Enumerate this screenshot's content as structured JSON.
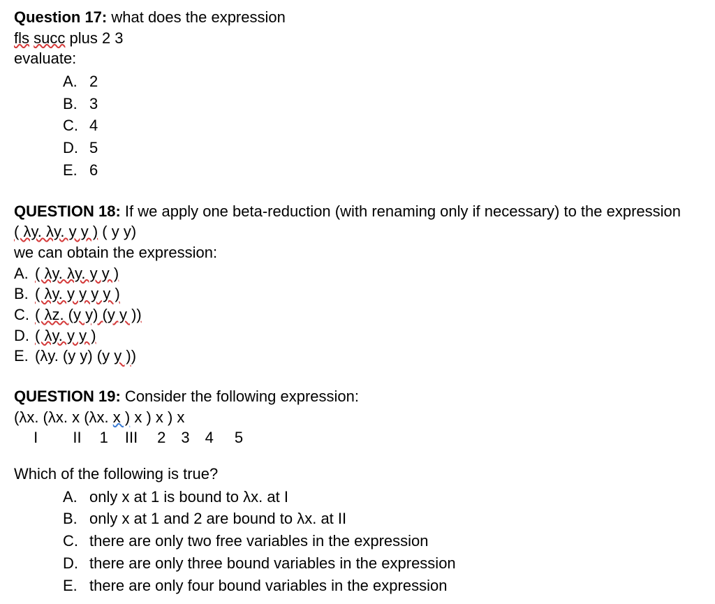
{
  "q17": {
    "label": "Question 17:",
    "prompt_tail": " what does the expression",
    "expr_fls": "fls",
    "expr_succ": "succ",
    "expr_rest": " plus 2 3",
    "evaluate": "evaluate:",
    "opts": {
      "A": "2",
      "B": "3",
      "C": "4",
      "D": "5",
      "E": "6"
    }
  },
  "q18": {
    "label": "QUESTION 18:",
    "prompt_tail": " If we apply one beta-reduction (with renaming only if necessary) to the expression",
    "expr_underlined": "( λy. λy. y y )",
    "expr_rest": " ( y y)",
    "line3": "we can obtain the expression:",
    "opts": {
      "A": {
        "u": "( λy. λy. y y )",
        "plain": ""
      },
      "B": {
        "u": "( λy. y y  y y )",
        "plain": ""
      },
      "C": {
        "u": "( λz. (y y) (y y ))",
        "plain": ""
      },
      "D": {
        "u": "( λy. y y )",
        "plain": ""
      },
      "E": {
        "plain_pre": "(λy. (y y) (y ",
        "u": "y )",
        "plain_post": ")"
      }
    }
  },
  "q19": {
    "label": "QUESTION 19:",
    "prompt_tail": " Consider the following expression:",
    "expr_pre": "(λx. (λx. x (λx. ",
    "expr_u": "x )",
    "expr_post": " x ) x ) x",
    "labels": {
      "I": "I",
      "II": "II",
      "n1": "1",
      "III": "III",
      "n2": "2",
      "n3": "3",
      "n4": "4",
      "n5": "5"
    },
    "which": "Which of the following is true?",
    "opts": {
      "A": "only x at 1 is bound to λx. at I",
      "B": "only x at 1 and 2 are bound to λx. at II",
      "C": "there are only two free variables in the expression",
      "D": "there are only three bound variables in the expression",
      "E": "there are only four bound variables in the expression"
    }
  }
}
